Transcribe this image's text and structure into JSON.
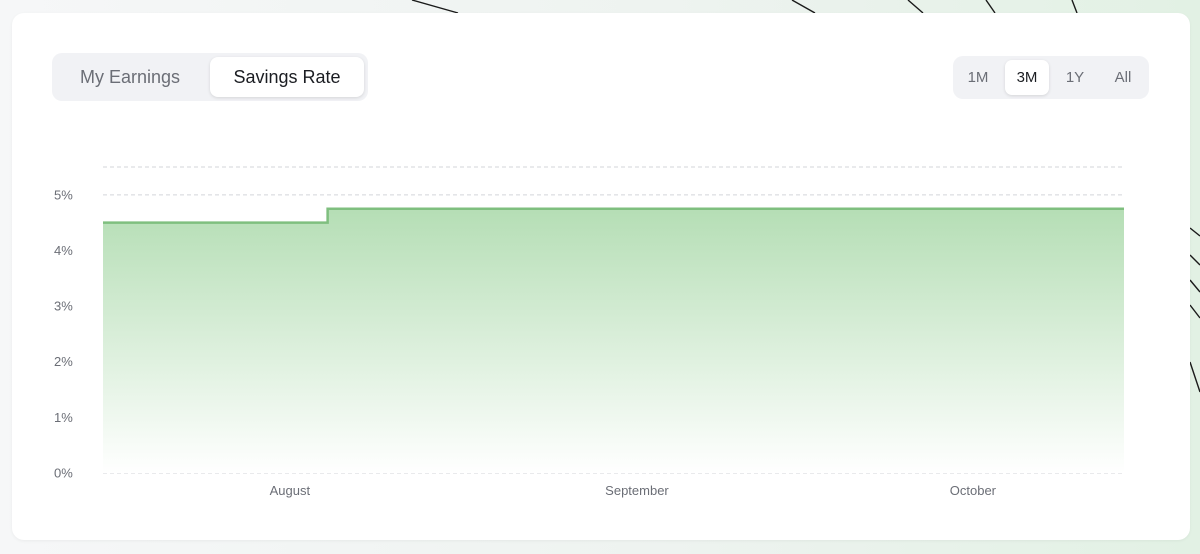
{
  "tabs": {
    "items": [
      {
        "label": "My Earnings",
        "active": false
      },
      {
        "label": "Savings Rate",
        "active": true
      }
    ]
  },
  "range": {
    "items": [
      {
        "label": "1M",
        "active": false
      },
      {
        "label": "3M",
        "active": true
      },
      {
        "label": "1Y",
        "active": false
      },
      {
        "label": "All",
        "active": false
      }
    ]
  },
  "chart_data": {
    "type": "area",
    "step": true,
    "x_categories": [
      "August",
      "September",
      "October"
    ],
    "y_ticks": [
      {
        "value": 0,
        "label": "0%"
      },
      {
        "value": 1,
        "label": "1%"
      },
      {
        "value": 2,
        "label": "2%"
      },
      {
        "value": 3,
        "label": "3%"
      },
      {
        "value": 4,
        "label": "4%"
      },
      {
        "value": 5,
        "label": "5%"
      }
    ],
    "ylim": [
      0,
      5.5
    ],
    "grid": true,
    "series": [
      {
        "values_pct": [
          4.5,
          4.5,
          4.75,
          4.75
        ],
        "change_position": "mid-August"
      }
    ],
    "colors": {
      "line": "#7fbf7f",
      "fill_top": "#b5deb5",
      "fill_bottom": "#ffffff",
      "grid": "#d3d5da"
    }
  }
}
